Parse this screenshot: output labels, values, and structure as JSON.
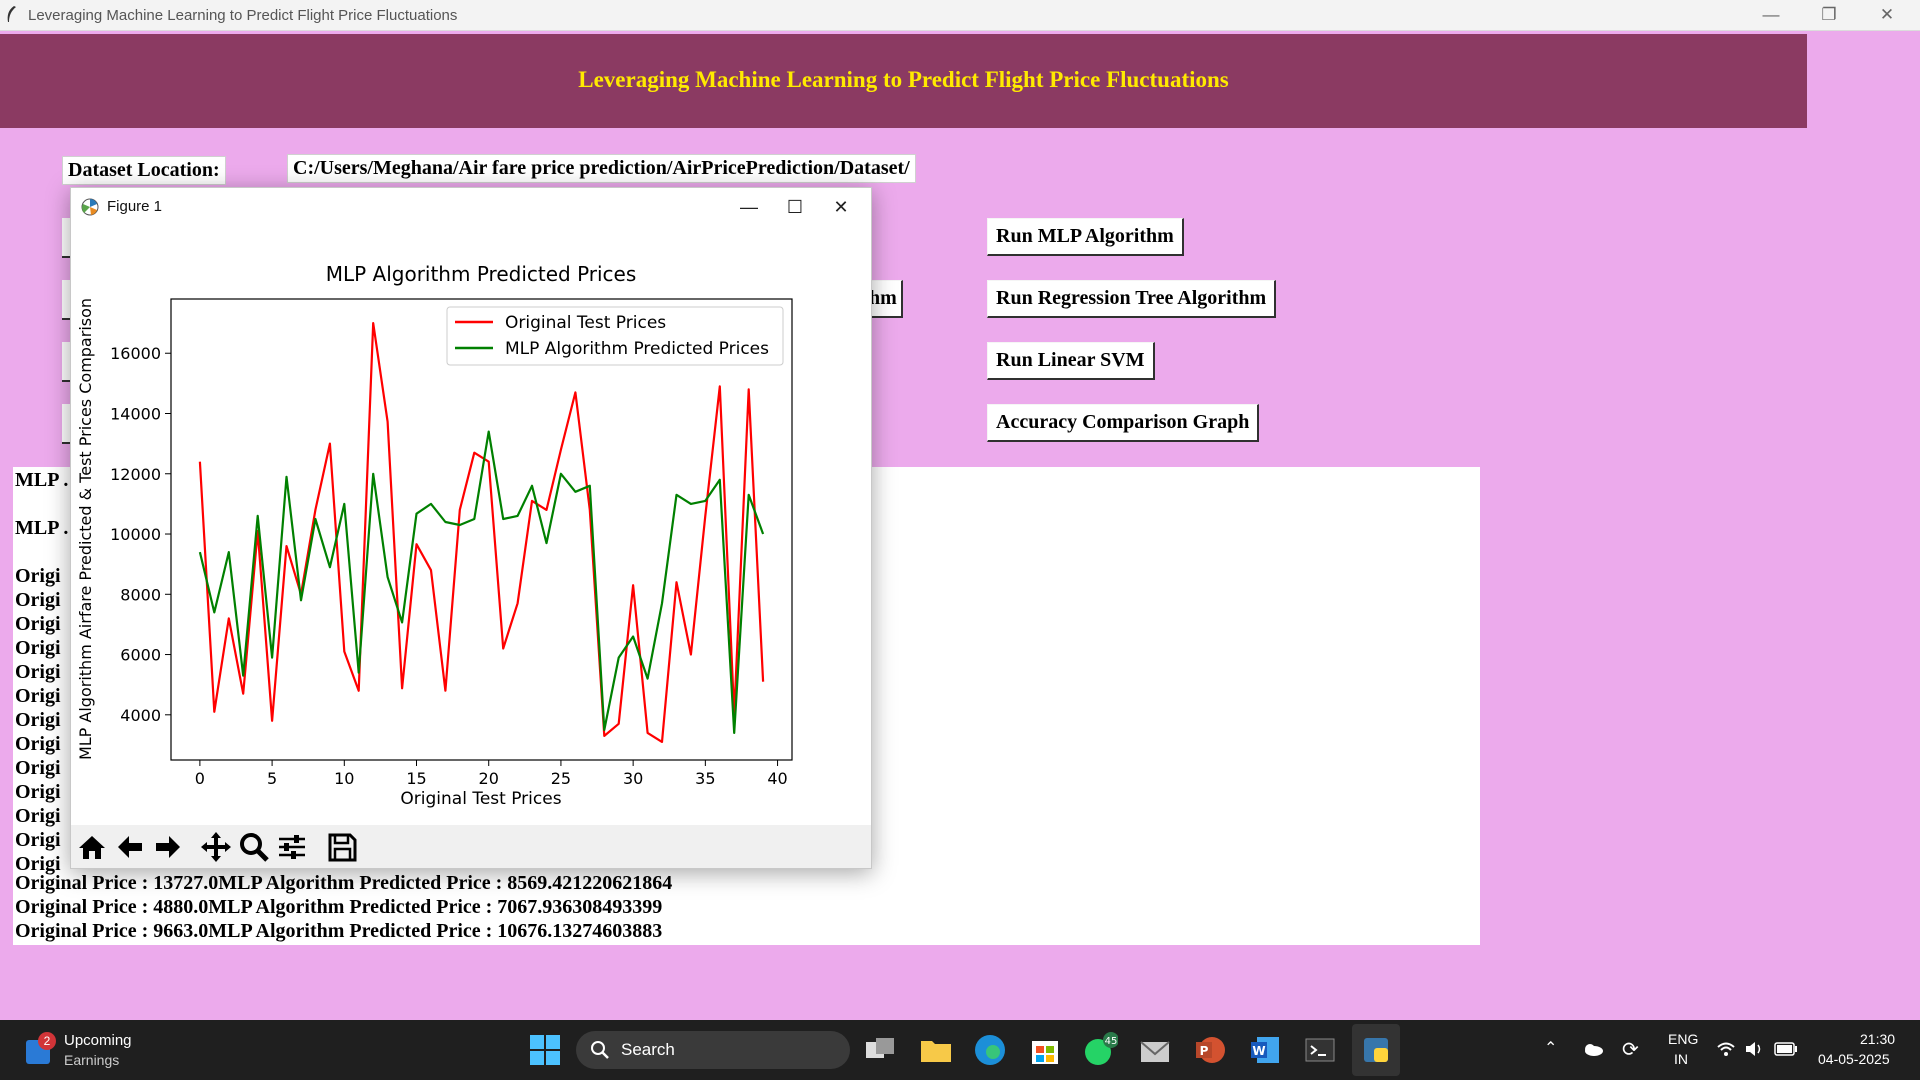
{
  "window": {
    "title": "Leveraging Machine Learning to Predict Flight Price Fluctuations"
  },
  "header": {
    "title": "Leveraging Machine Learning to Predict Flight Price Fluctuations"
  },
  "dataset": {
    "label": "Dataset Location:",
    "path": "C:/Users/Meghana/Air fare price prediction/AirPricePrediction/Dataset/"
  },
  "buttons": {
    "mlp": "Run MLP Algorithm",
    "regression_tree": "Run Regression Tree Algorithm",
    "linear_svm": "Run Linear SVM",
    "accuracy_graph": "Accuracy Comparison Graph",
    "hidden_partial": "hm"
  },
  "output": {
    "partial_lines": [
      "MLP .",
      "MLP .",
      "Origi",
      "Origi",
      "Origi",
      "Origi",
      "Origi",
      "Origi",
      "Origi",
      "Origi",
      "Origi",
      "Origi",
      "Origi",
      "Origi",
      "Origi"
    ],
    "lines": [
      "Original Price : 13727.0MLP Algorithm Predicted Price : 8569.421220621864",
      "Original Price : 4880.0MLP Algorithm Predicted Price : 7067.936308493399",
      "Original Price : 9663.0MLP Algorithm Predicted Price : 10676.13274603883"
    ]
  },
  "figure": {
    "window_title": "Figure 1",
    "toolbar": [
      "home-icon",
      "back-icon",
      "forward-icon",
      "pan-icon",
      "zoom-icon",
      "configure-icon",
      "save-icon"
    ]
  },
  "chart_data": {
    "type": "line",
    "title": "MLP Algorithm Predicted Prices",
    "xlabel": "Original Test Prices",
    "ylabel": "MLP Algorithm Airfare Predicted & Test Prices Comparison",
    "xlim": [
      -2,
      41
    ],
    "ylim": [
      2500,
      17800
    ],
    "xticks": [
      0,
      5,
      10,
      15,
      20,
      25,
      30,
      35,
      40
    ],
    "yticks": [
      4000,
      6000,
      8000,
      10000,
      12000,
      14000,
      16000
    ],
    "legend_position": "top-right",
    "grid": false,
    "x": [
      0,
      1,
      2,
      3,
      4,
      5,
      6,
      7,
      8,
      9,
      10,
      11,
      12,
      13,
      14,
      15,
      16,
      17,
      18,
      19,
      20,
      21,
      22,
      23,
      24,
      25,
      26,
      27,
      28,
      29,
      30,
      31,
      32,
      33,
      34,
      35,
      36,
      37,
      38,
      39
    ],
    "series": [
      {
        "name": "Original Test Prices",
        "color": "#ff0000",
        "values": [
          12400,
          4100,
          7200,
          4700,
          10100,
          3800,
          9600,
          8000,
          10800,
          13000,
          6100,
          4800,
          17000,
          13727,
          4880,
          9663,
          8800,
          4800,
          10800,
          12700,
          12400,
          6200,
          7700,
          11100,
          10800,
          12800,
          14700,
          10800,
          3300,
          3700,
          8300,
          3400,
          3100,
          8400,
          6000,
          10600,
          14900,
          4000,
          14800,
          5100
        ]
      },
      {
        "name": "MLP Algorithm Predicted Prices",
        "color": "#008000",
        "values": [
          9400,
          7400,
          9400,
          5300,
          10600,
          5900,
          11900,
          7800,
          10500,
          8900,
          11000,
          5400,
          12000,
          8569,
          7068,
          10676,
          11000,
          10400,
          10300,
          10500,
          13400,
          10500,
          10600,
          11600,
          9700,
          12000,
          11400,
          11600,
          3500,
          5900,
          6600,
          5200,
          7700,
          11300,
          11000,
          11100,
          11800,
          3400,
          11300,
          10000
        ]
      }
    ]
  }
}
